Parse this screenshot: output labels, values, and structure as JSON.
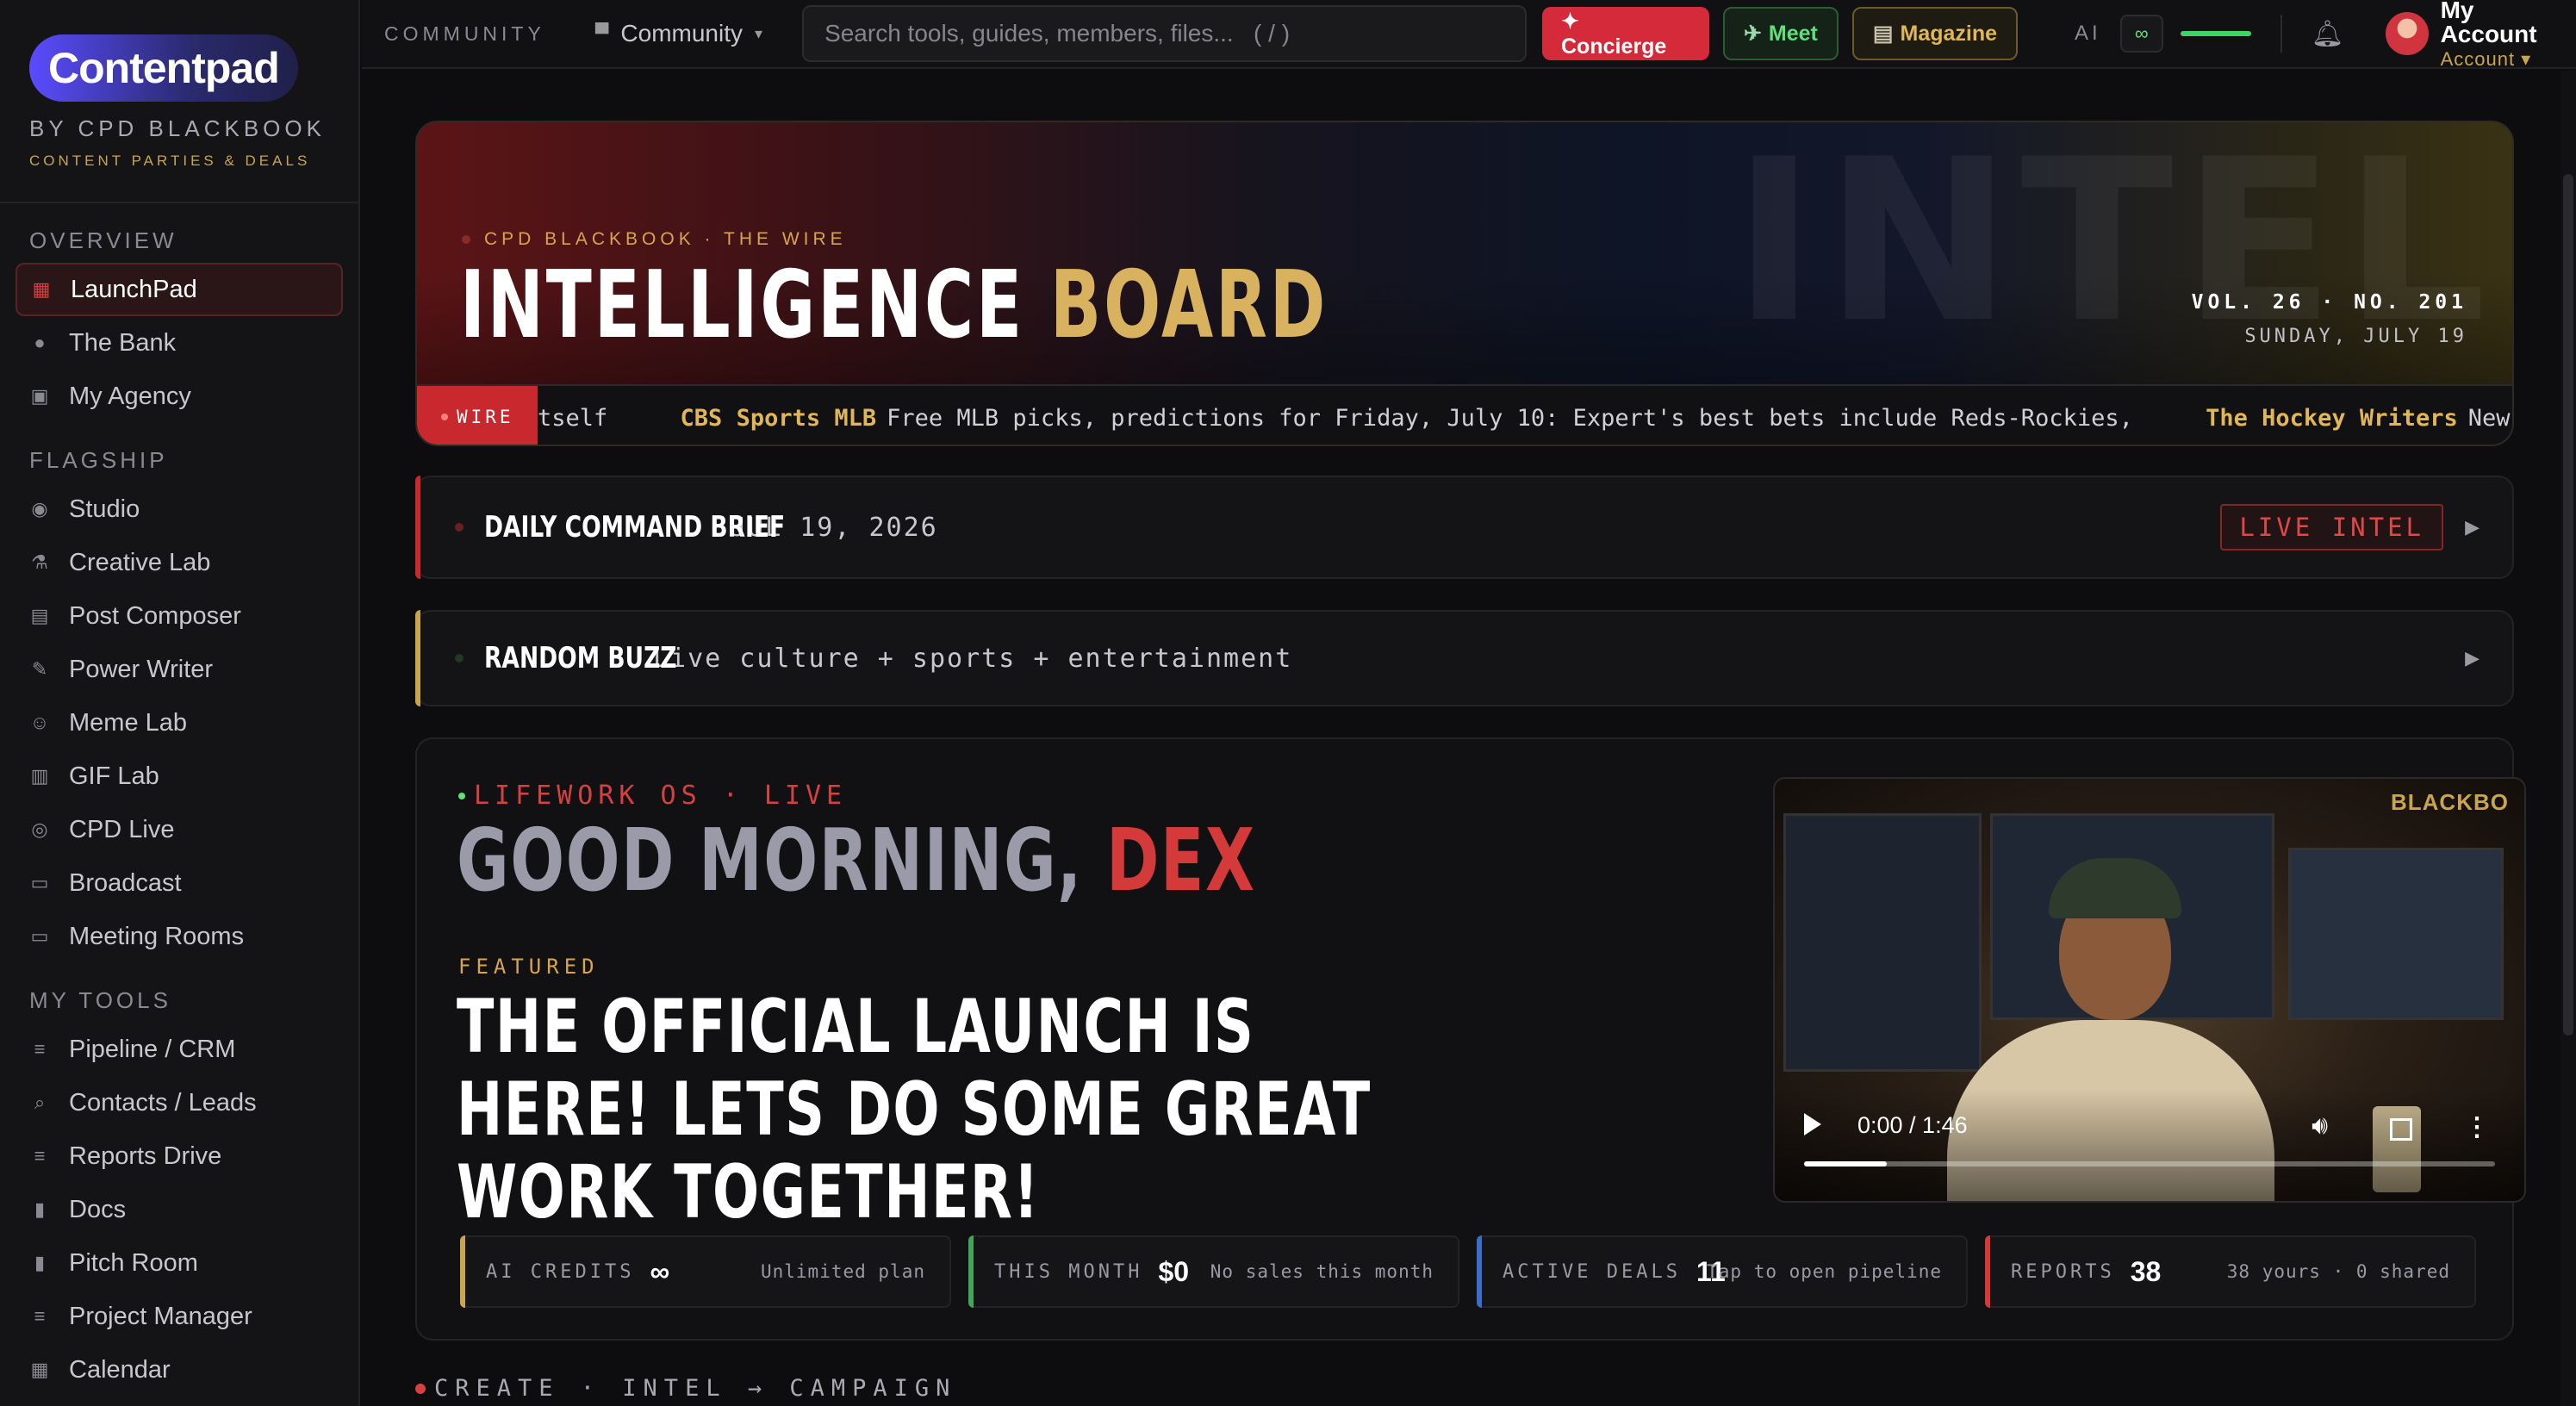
{
  "brand": {
    "logo": "Contentpad",
    "by": "BY CPD BLACKBOOK",
    "tagline": "CONTENT PARTIES & DEALS"
  },
  "sidebar": {
    "sections": [
      {
        "title": "OVERVIEW",
        "items": [
          {
            "label": "LaunchPad",
            "icon": "grid-icon",
            "active": true
          },
          {
            "label": "The Bank",
            "icon": "info-icon"
          },
          {
            "label": "My Agency",
            "icon": "briefcase-icon"
          }
        ]
      },
      {
        "title": "FLAGSHIP",
        "items": [
          {
            "label": "Studio",
            "icon": "target-icon"
          },
          {
            "label": "Creative Lab",
            "icon": "flask-icon"
          },
          {
            "label": "Post Composer",
            "icon": "document-icon"
          },
          {
            "label": "Power Writer",
            "icon": "pen-icon"
          },
          {
            "label": "Meme Lab",
            "icon": "smile-icon"
          },
          {
            "label": "GIF Lab",
            "icon": "film-icon"
          },
          {
            "label": "CPD Live",
            "icon": "broadcast-icon"
          },
          {
            "label": "Broadcast",
            "icon": "video-icon"
          },
          {
            "label": "Meeting Rooms",
            "icon": "video-icon"
          }
        ]
      },
      {
        "title": "MY TOOLS",
        "items": [
          {
            "label": "Pipeline / CRM",
            "icon": "lines-icon"
          },
          {
            "label": "Contacts / Leads",
            "icon": "search-icon"
          },
          {
            "label": "Reports Drive",
            "icon": "lines-icon"
          },
          {
            "label": "Docs",
            "icon": "doc-icon"
          },
          {
            "label": "Pitch Room",
            "icon": "doc-icon"
          },
          {
            "label": "Project Manager",
            "icon": "lines-icon"
          },
          {
            "label": "Calendar",
            "icon": "calendar-icon"
          }
        ]
      }
    ]
  },
  "topbar": {
    "community_label": "COMMUNITY",
    "community_select": "Community",
    "search_placeholder": "Search tools, guides, members, files...   ( / )",
    "concierge": "✦ Concierge",
    "meet": "Meet",
    "magazine": "Magazine",
    "ai_label": "AI",
    "ai_badge": "∞",
    "account_title": "My Account",
    "account_sub": "Account ▾"
  },
  "hero": {
    "kicker": "CPD BLACKBOOK · THE WIRE",
    "title_a": "INTELLIGENCE",
    "title_b": "BOARD",
    "watermark": "INTEL",
    "vol": "VOL. 26 · NO. 201",
    "date": "SUNDAY, JULY 19",
    "wire_badge": "WIRE",
    "ticker": [
      {
        "source": "",
        "text": "tself"
      },
      {
        "source": "CBS Sports MLB",
        "text": "Free MLB picks, predictions for Friday, July 10: Expert's best bets include Reds-Rockies,"
      },
      {
        "source": "The Hockey Writers",
        "text": "New York Ranger"
      }
    ]
  },
  "brief": {
    "title": "DAILY COMMAND BRIEF",
    "date": "JUL 19, 2026",
    "badge": "LIVE INTEL"
  },
  "buzz": {
    "title": "RANDOM BUZZ",
    "subtitle": "Live culture + sports + entertainment"
  },
  "panel": {
    "kicker": "LIFEWORK OS · LIVE",
    "greet_a": "GOOD MORNING,",
    "greet_b": "DEX",
    "featured_label": "FEATURED",
    "featured": "THE OFFICIAL LAUNCH IS HERE! LETS DO SOME GREAT WORK TOGETHER!",
    "video": {
      "sign": "BLACKBO",
      "time": "0:00 / 1:46",
      "progress": 0.12
    },
    "stats": [
      {
        "label": "AI CREDITS",
        "value": "∞",
        "note": "Unlimited plan",
        "color": "#c9a54e"
      },
      {
        "label": "THIS MONTH",
        "value": "$0",
        "note": "No sales this month",
        "color": "#3ea85a"
      },
      {
        "label": "ACTIVE DEALS",
        "value": "11",
        "note": "Tap to open pipeline",
        "color": "#3a6ec8"
      },
      {
        "label": "REPORTS",
        "value": "38",
        "note": "38 yours · 0 shared",
        "color": "#d43a3a"
      }
    ]
  },
  "create_label": "CREATE · INTEL → CAMPAIGN"
}
